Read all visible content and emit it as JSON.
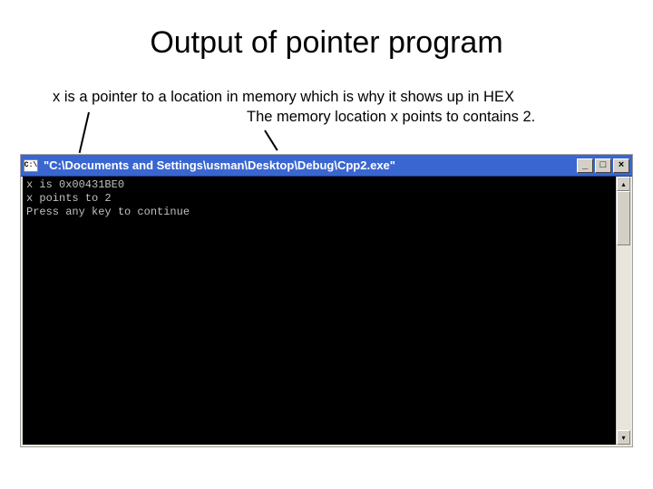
{
  "title": "Output of pointer program",
  "annotations": {
    "line1": "x is a pointer to a location in memory which is why it shows up in HEX",
    "line2": "The memory location x points to contains 2."
  },
  "window": {
    "icon_text": "C:\\",
    "title": "\"C:\\Documents and Settings\\usman\\Desktop\\Debug\\Cpp2.exe\"",
    "buttons": {
      "minimize": "_",
      "maximize": "□",
      "close": "×"
    },
    "scrollbar": {
      "up": "▴",
      "down": "▾"
    }
  },
  "console": {
    "line1": "x is 0x00431BE0",
    "line2": "x points to 2",
    "line3": "Press any key to continue"
  }
}
